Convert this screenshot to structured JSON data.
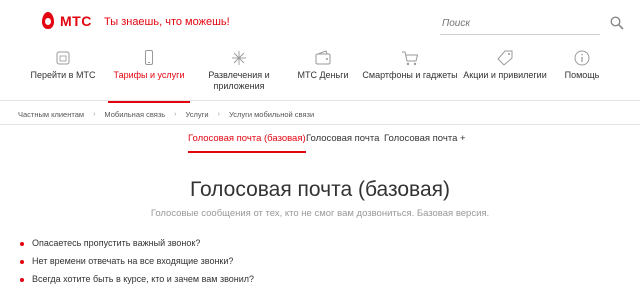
{
  "brand": {
    "logo_text": "МТС",
    "slogan": "Ты знаешь, что можешь!",
    "accent": "#e30611"
  },
  "search": {
    "placeholder": "Поиск",
    "icon": "search-icon"
  },
  "nav": [
    {
      "label": "Перейти в МТС",
      "icon": "sim-card-icon"
    },
    {
      "label": "Тарифы и услуги",
      "icon": "phone-icon",
      "active": true
    },
    {
      "label": "Развлечения и приложения",
      "icon": "sparkle-icon"
    },
    {
      "label": "МТС Деньги",
      "icon": "wallet-icon"
    },
    {
      "label": "Смартфоны и гаджеты",
      "icon": "cart-icon"
    },
    {
      "label": "Акции и привилегии",
      "icon": "tag-icon"
    },
    {
      "label": "Помощь",
      "icon": "info-icon"
    }
  ],
  "breadcrumb": [
    "Частным клиентам",
    "Мобильная связь",
    "Услуги",
    "Услуги мобильной связи"
  ],
  "tabs": [
    {
      "label": "Голосовая почта (базовая)",
      "active": true
    },
    {
      "label": "Голосовая почта"
    },
    {
      "label": "Голосовая почта +"
    }
  ],
  "page": {
    "title": "Голосовая почта (базовая)",
    "subtitle": "Голосовые сообщения от тех, кто не смог вам дозвониться. Базовая версия."
  },
  "bullets": [
    "Опасаетесь пропустить важный звонок?",
    "Нет времени отвечать на все входящие звонки?",
    "Всегда хотите быть в курсе, кто и зачем вам звонил?"
  ]
}
